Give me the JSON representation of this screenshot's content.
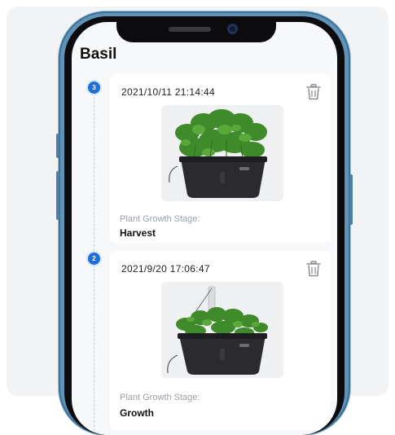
{
  "page": {
    "title": "Basil"
  },
  "records": [
    {
      "index": "3",
      "timestamp": "2021/10/11  21:14:44",
      "stage_label": "Plant Growth Stage:",
      "stage_value": "Harvest",
      "icon": "trash-icon"
    },
    {
      "index": "2",
      "timestamp": "2021/9/20  17:06:47",
      "stage_label": "Plant Growth Stage:",
      "stage_value": "Growth",
      "icon": "trash-icon"
    }
  ],
  "colors": {
    "accent": "#1f6fd6",
    "phone_frame": "#5f93b8",
    "screen_bg": "#f7f8fa",
    "planter": "#2b2b2d",
    "leaf": "#3f8a2a"
  }
}
